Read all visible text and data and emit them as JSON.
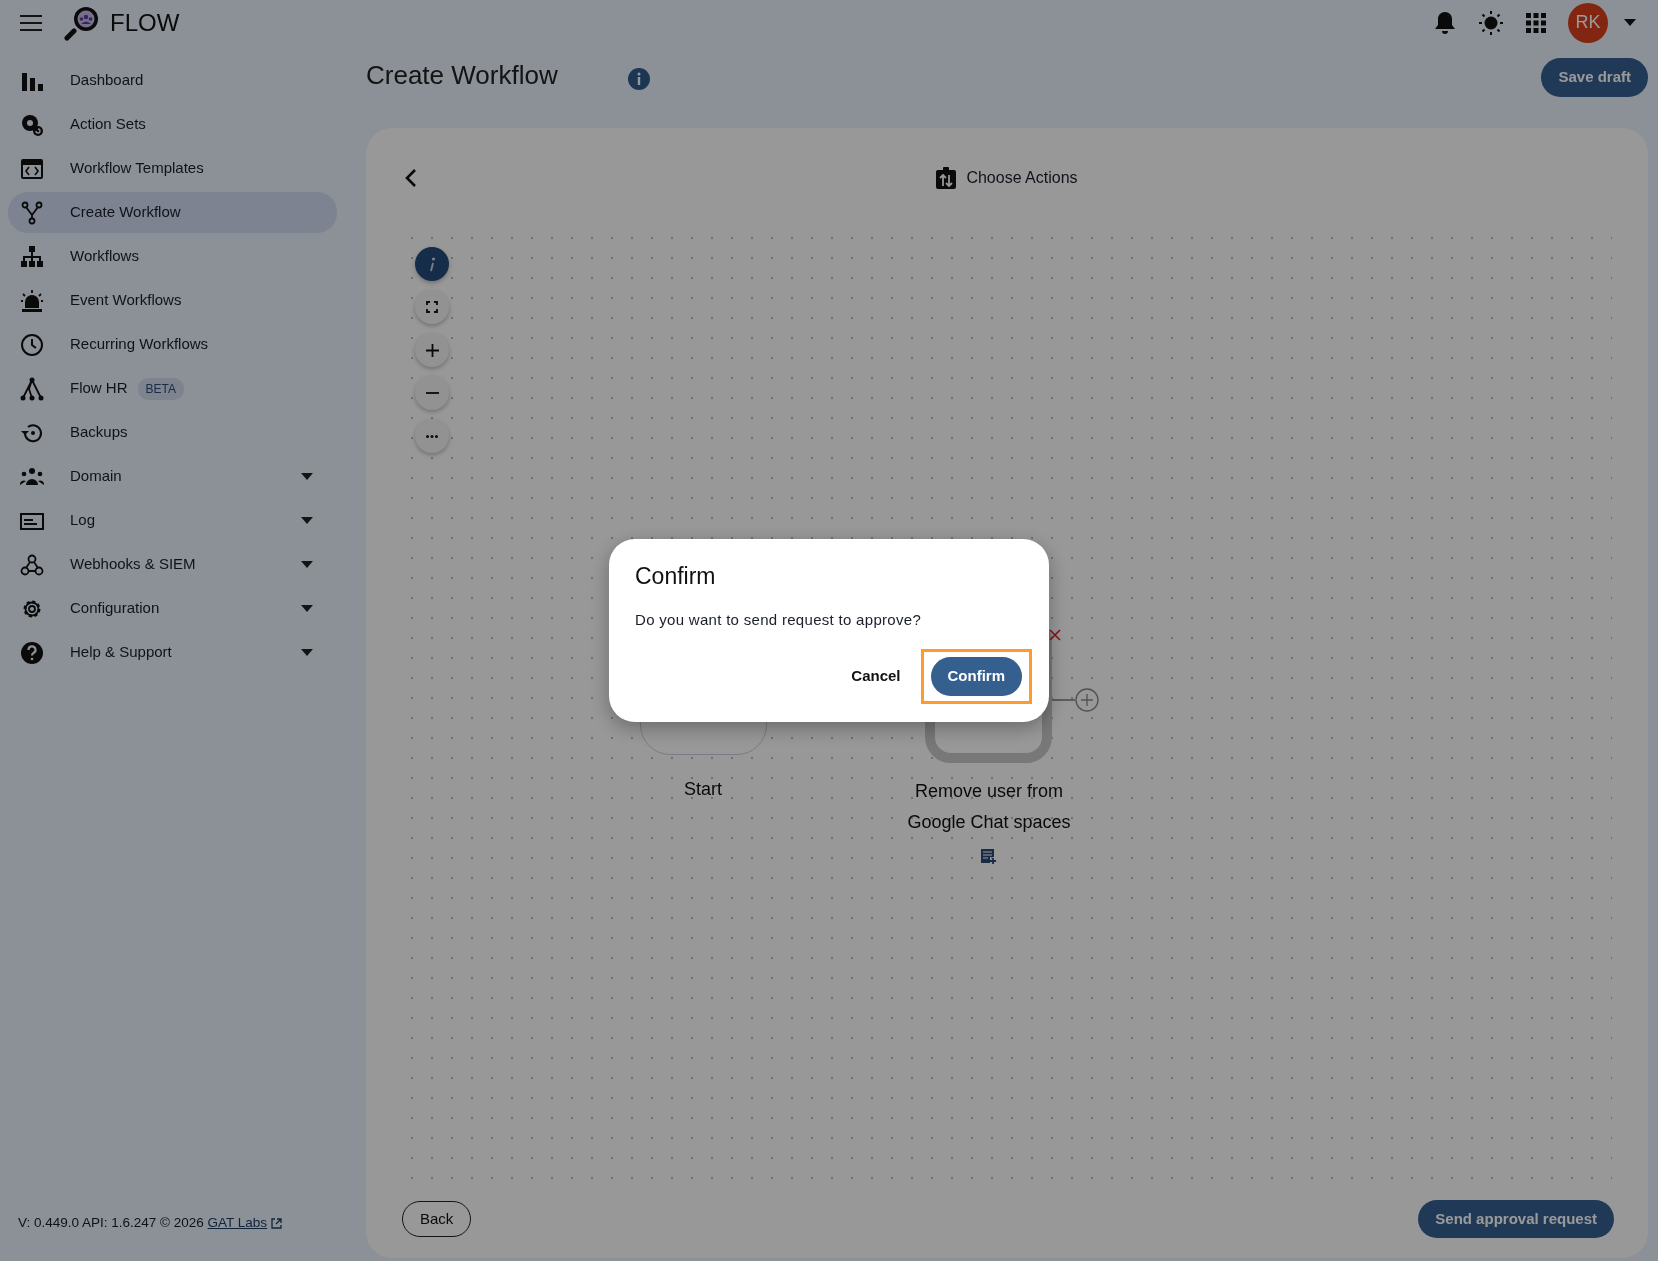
{
  "header": {
    "app_name": "FLOW",
    "avatar_initials": "RK"
  },
  "sidebar": {
    "items": [
      {
        "label": "Dashboard",
        "selected": false,
        "expandable": false
      },
      {
        "label": "Action Sets",
        "selected": false,
        "expandable": false
      },
      {
        "label": "Workflow Templates",
        "selected": false,
        "expandable": false
      },
      {
        "label": "Create Workflow",
        "selected": true,
        "expandable": false
      },
      {
        "label": "Workflows",
        "selected": false,
        "expandable": false
      },
      {
        "label": "Event Workflows",
        "selected": false,
        "expandable": false
      },
      {
        "label": "Recurring Workflows",
        "selected": false,
        "expandable": false
      },
      {
        "label": "Flow HR",
        "selected": false,
        "expandable": false,
        "badge": "BETA"
      },
      {
        "label": "Backups",
        "selected": false,
        "expandable": false
      },
      {
        "label": "Domain",
        "selected": false,
        "expandable": true
      },
      {
        "label": "Log",
        "selected": false,
        "expandable": true
      },
      {
        "label": "Webhooks & SIEM",
        "selected": false,
        "expandable": true
      },
      {
        "label": "Configuration",
        "selected": false,
        "expandable": true
      },
      {
        "label": "Help & Support",
        "selected": false,
        "expandable": true
      }
    ],
    "footer": {
      "text": "V: 0.449.0  API: 1.6.247  © 2026",
      "link": "GAT Labs"
    }
  },
  "page": {
    "title": "Create Workflow",
    "save_button": "Save draft"
  },
  "canvas": {
    "step_title": "Choose Actions",
    "nodes": [
      {
        "kind": "start",
        "label": "Start"
      },
      {
        "kind": "action",
        "label": "Remove user from Google Chat spaces"
      }
    ],
    "back_button": "Back",
    "submit_button": "Send approval request"
  },
  "dialog": {
    "title": "Confirm",
    "message": "Do you want to send request to approve?",
    "buttons": [
      {
        "kind": "text",
        "label": "Cancel",
        "highlighted": false
      },
      {
        "kind": "primary",
        "label": "Confirm",
        "highlighted": true
      }
    ]
  }
}
